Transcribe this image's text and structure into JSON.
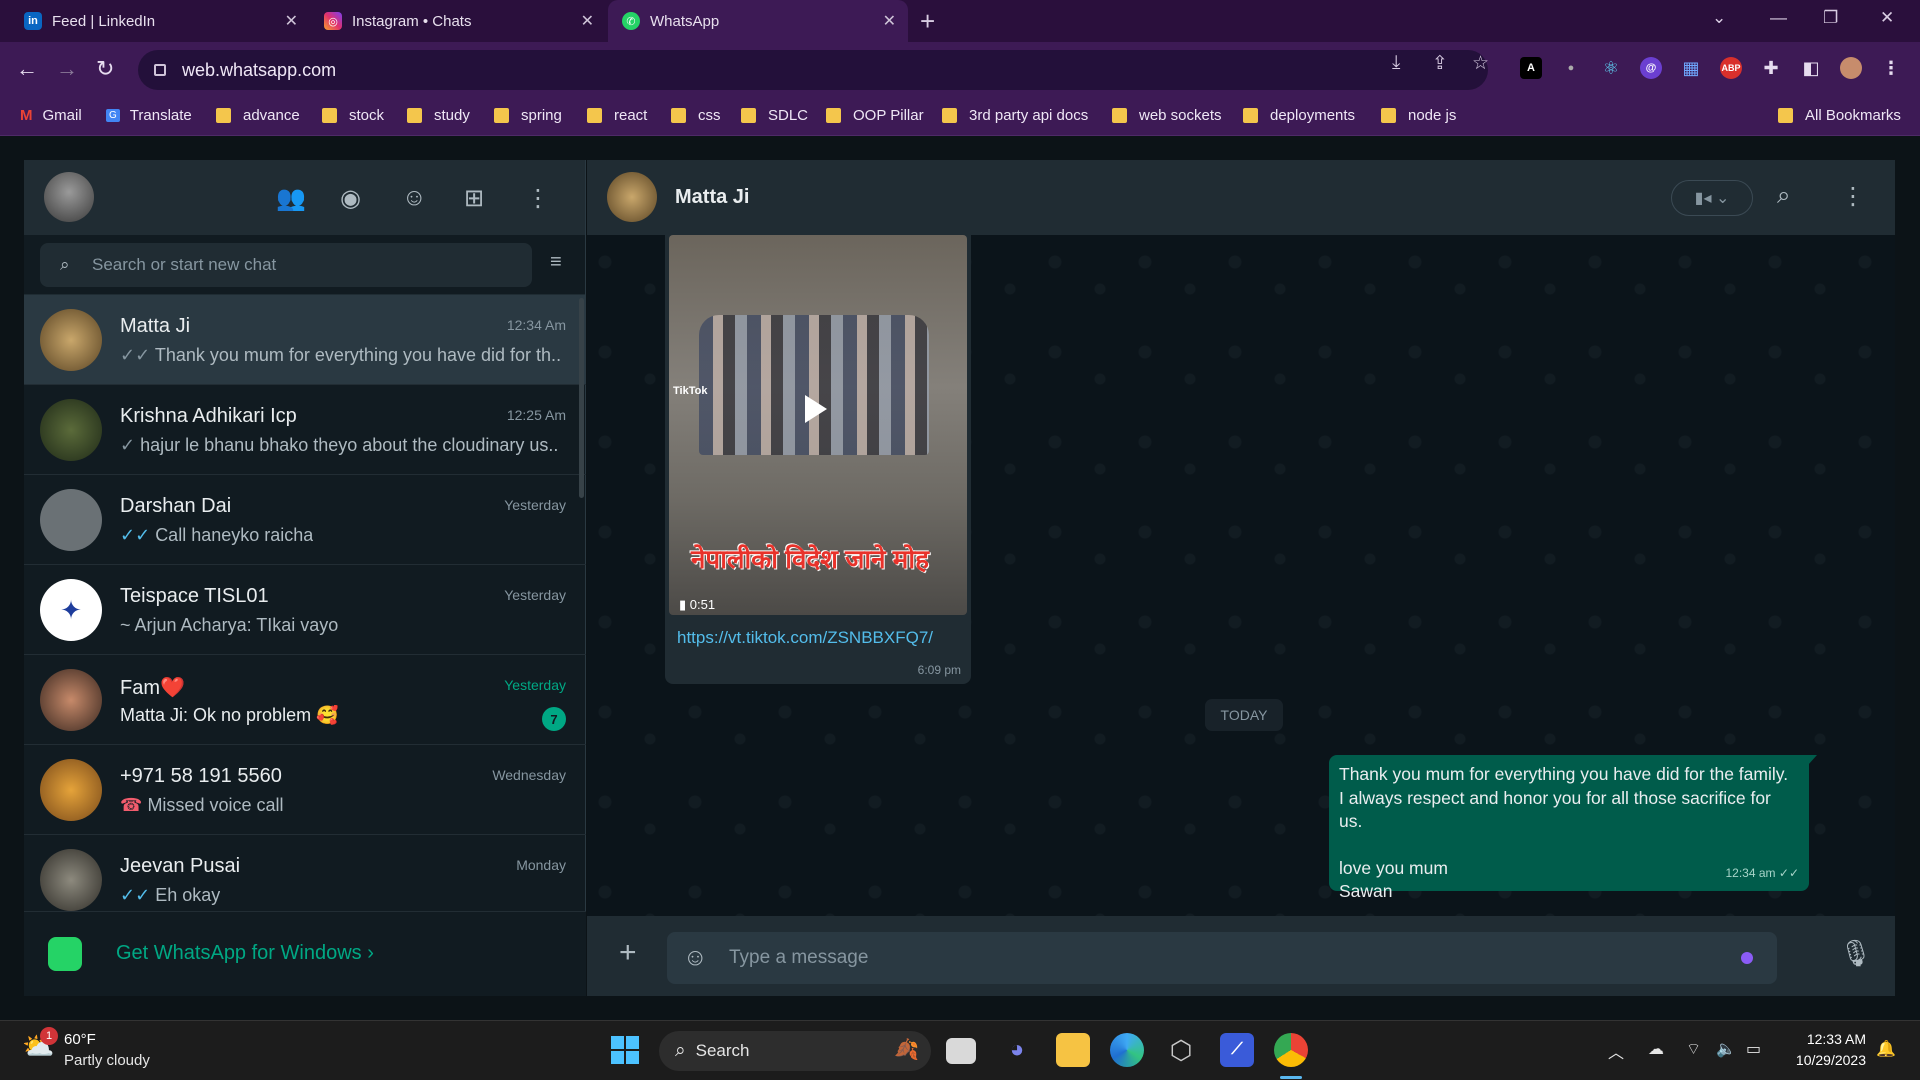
{
  "browser": {
    "tabs": [
      {
        "title": "Feed | LinkedIn",
        "icon": "linkedin-icon",
        "color": "#0a66c2"
      },
      {
        "title": "Instagram • Chats",
        "icon": "instagram-icon",
        "color": "#e1306c"
      },
      {
        "title": "WhatsApp",
        "icon": "whatsapp-icon",
        "color": "#25d366",
        "active": true
      }
    ],
    "url": "web.whatsapp.com",
    "bookmarks": [
      "Gmail",
      "Translate",
      "advance",
      "stock",
      "study",
      "spring",
      "react",
      "css",
      "SDLC",
      "OOP Pillar",
      "3rd party api docs",
      "web sockets",
      "deployments",
      "node js"
    ],
    "all_bookmarks": "All Bookmarks",
    "extensions": {
      "abp": "ABP",
      "a": "A"
    }
  },
  "sidebar": {
    "search_placeholder": "Search or start new chat",
    "chats": [
      {
        "name": "Matta Ji",
        "time": "12:34 Am",
        "preview": "Thank you mum for everything you have did for th...",
        "ticks": "✓✓",
        "selected": true
      },
      {
        "name": "Krishna Adhikari Icp",
        "time": "12:25 Am",
        "preview": "hajur le bhanu bhako theyo about the cloudinary us...",
        "ticks": "✓"
      },
      {
        "name": "Darshan Dai",
        "time": "Yesterday",
        "preview": "Call haneyko raicha",
        "ticks": "✓✓"
      },
      {
        "name": "Teispace TISL01",
        "time": "Yesterday",
        "preview": "~ Arjun Acharya: TIkai vayo",
        "ticks": ""
      },
      {
        "name": "Fam",
        "emoji": "❤️",
        "time": "Yesterday",
        "preview": "Matta Ji: Ok  no problem 🥰",
        "unread": "7"
      },
      {
        "name": "+971 58 191 5560",
        "time": "Wednesday",
        "preview": "Missed voice call",
        "ticks": ""
      },
      {
        "name": "Jeevan Pusai",
        "time": "Monday",
        "preview": "Eh okay",
        "ticks": "✓✓"
      }
    ],
    "get_app": "Get WhatsApp for Windows"
  },
  "conversation": {
    "contact": "Matta Ji",
    "video": {
      "caption": "नेपालीको विदेश जाने मोह",
      "duration": "0:51",
      "tiktok": "TikTok"
    },
    "incoming_link": "https://vt.tiktok.com/ZSNBBXFQ7/",
    "incoming_time": "6:09 pm",
    "date_divider": "TODAY",
    "outgoing": {
      "lines": [
        "Thank you mum for everything you have did for the family.",
        "I always respect and honor you for all those sacrifice for us.",
        "",
        "love you mum",
        "Sawan"
      ],
      "time": "12:34 am"
    },
    "message_placeholder": "Type a message"
  },
  "taskbar": {
    "weather_temp": "60°F",
    "weather_desc": "Partly cloudy",
    "weather_badge": "1",
    "search_label": "Search",
    "time": "12:33 AM",
    "date": "10/29/2023"
  }
}
